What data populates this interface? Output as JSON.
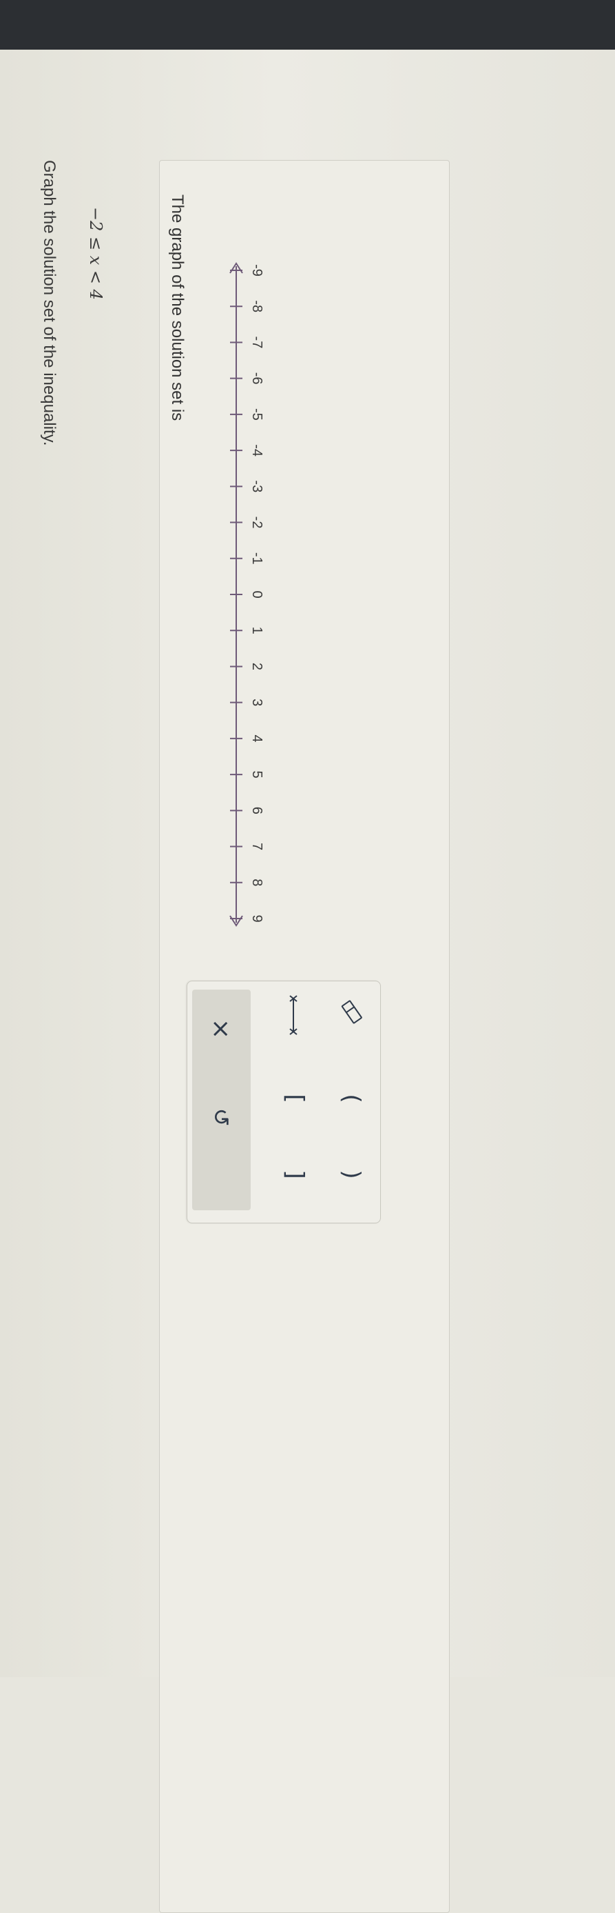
{
  "question": {
    "title": "Graph the solution set of the inequality.",
    "inequality": "−2 ≤ x < 4"
  },
  "answer": {
    "prompt": "The graph of the solution set is"
  },
  "number_line": {
    "min": -9,
    "max": 9,
    "ticks": [
      "-9",
      "-8",
      "-7",
      "-6",
      "-5",
      "-4",
      "-3",
      "-2",
      "-1",
      "0",
      "1",
      "2",
      "3",
      "4",
      "5",
      "6",
      "7",
      "8",
      "9"
    ]
  },
  "palette": {
    "open_paren": "(",
    "close_paren": ")",
    "open_bracket": "[",
    "close_bracket": "]",
    "clear": "×",
    "undo": "↺",
    "icons": [
      "eraser-icon",
      "segment-tool-icon"
    ]
  },
  "colors": {
    "axis": "#6e5a78",
    "text": "#3a3a3a",
    "top_bar": "#2c2f33"
  }
}
